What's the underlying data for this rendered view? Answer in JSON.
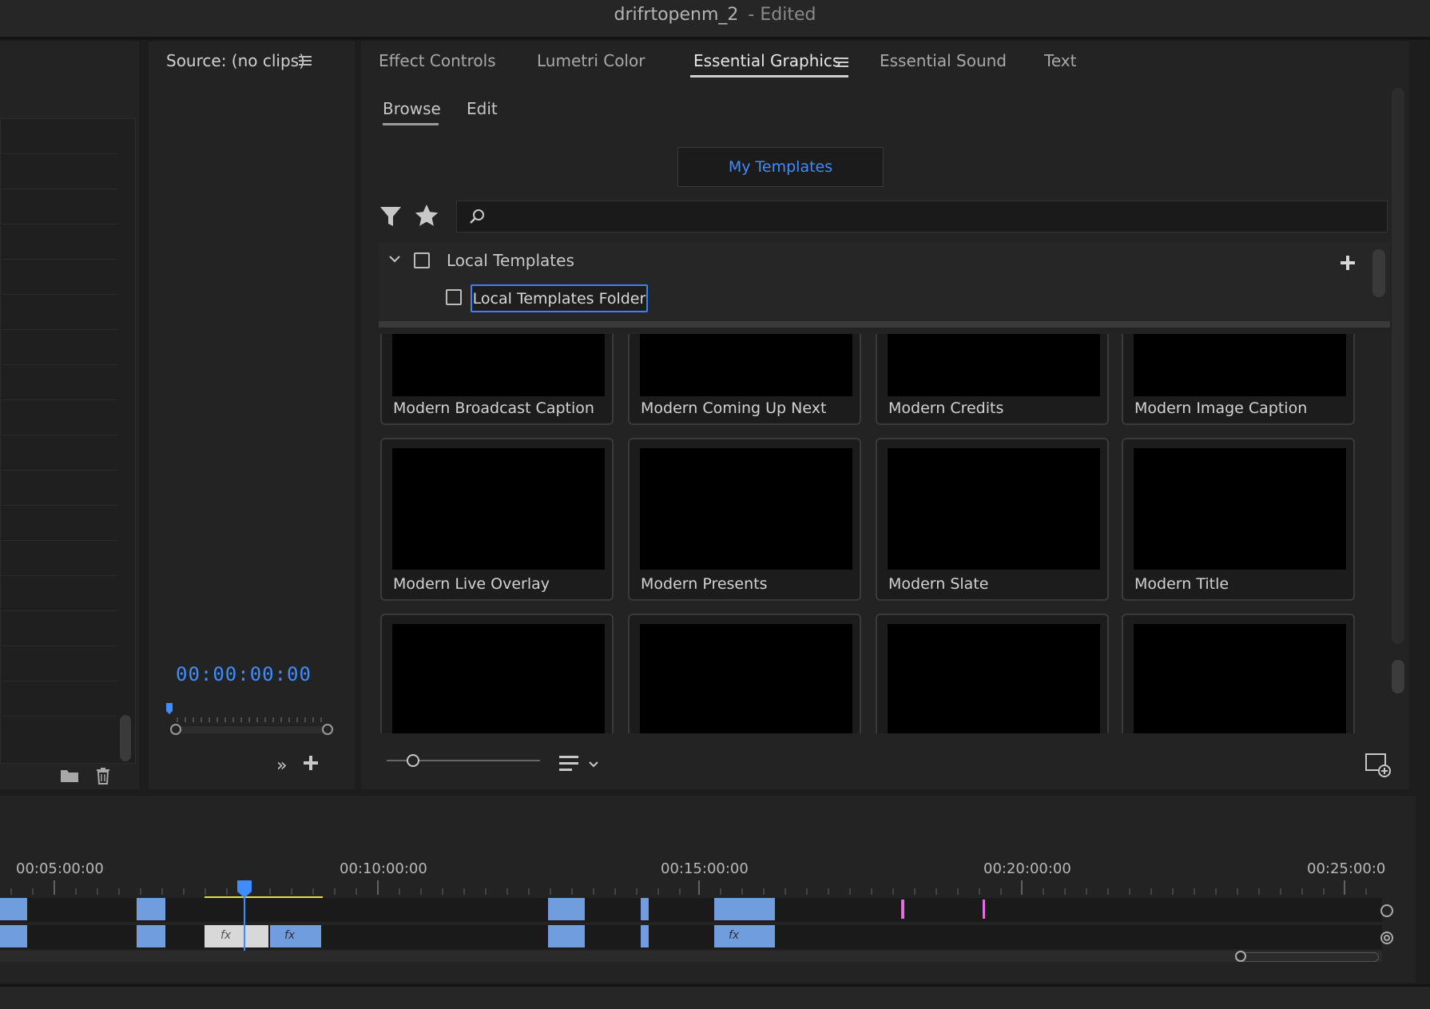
{
  "window": {
    "title": "drifrtopenm_2",
    "status": "- Edited"
  },
  "source_panel": {
    "title": "Source: (no clips)",
    "timecode": "00:00:00:00"
  },
  "tabs": [
    {
      "label": "Effect Controls"
    },
    {
      "label": "Lumetri Color"
    },
    {
      "label": "Essential Graphics"
    },
    {
      "label": "Essential Sound"
    },
    {
      "label": "Text"
    }
  ],
  "subtabs": {
    "browse": "Browse",
    "edit": "Edit"
  },
  "my_templates": "My Templates",
  "search": {
    "placeholder": ""
  },
  "local_templates": {
    "label": "Local Templates",
    "folder": "Local Templates Folder"
  },
  "templates": [
    "Modern Broadcast Caption",
    "Modern Coming Up Next",
    "Modern Credits",
    "Modern Image Caption",
    "Modern Live Overlay",
    "Modern Presents",
    "Modern Slate",
    "Modern Title"
  ],
  "timeline": {
    "ticks": [
      "00:05:00:00",
      "00:10:00:00",
      "00:15:00:00",
      "00:20:00:00",
      "00:25:00:0"
    ]
  },
  "colors": {
    "accent": "#3f8cff",
    "clip": "#6f9dde",
    "marker": "#e070e0",
    "work_area": "#e8e040"
  },
  "icons": [
    "menu-icon",
    "filter-icon",
    "star-icon",
    "search-icon",
    "chevron-down-icon",
    "plus-icon",
    "folder-icon",
    "trash-icon",
    "double-chevron-right-icon",
    "list-view-icon",
    "new-item-icon",
    "slider-handle-icon"
  ]
}
